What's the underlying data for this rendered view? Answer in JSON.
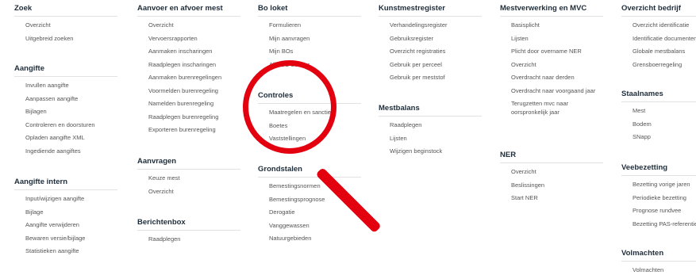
{
  "columns": [
    {
      "sections": [
        {
          "title": "Zoek",
          "items": [
            "Overzicht",
            "Uitgebreid zoeken"
          ]
        },
        {
          "title": "Aangifte",
          "items": [
            "Invullen aangifte",
            "Aanpassen aangifte",
            "Bijlagen",
            "Controleren en doorsturen",
            "Opladen aangifte XML",
            "Ingediende aangiftes"
          ]
        },
        {
          "title": "Aangifte intern",
          "items": [
            "Input/wijzigen aangifte",
            "Bijlage",
            "Aangifte verwijderen",
            "Bewaren versie/bijlage",
            "Statistieken aangifte"
          ]
        }
      ]
    },
    {
      "sections": [
        {
          "title": "Aanvoer en afvoer mest",
          "items": [
            "Overzicht",
            "Vervoersrapporten",
            "Aanmaken inscharingen",
            "Raadplegen inscharingen",
            "Aanmaken burenregelingen",
            "Voormelden burenregeling",
            "Namelden burenregeling",
            "Raadplegen burenregeling",
            "Exporteren burenregeling"
          ]
        },
        {
          "title": "Aanvragen",
          "items": [
            "Keuze mest",
            "Overzicht"
          ]
        },
        {
          "title": "Berichtenbox",
          "items": [
            "Raadplegen"
          ]
        }
      ]
    },
    {
      "sections": [
        {
          "title": "Bo loket",
          "items": [
            "Formulieren",
            "Mijn aanvragen",
            "Mijn BOs",
            "Alle BO-beheer"
          ]
        },
        {
          "title": "Controles",
          "items": [
            "Maatregelen en sancties",
            "Boetes",
            "Vaststellingen"
          ]
        },
        {
          "title": "Grondstalen",
          "items": [
            "Bemestingsnormen",
            "Bemestingsprognose",
            "Derogatie",
            "Vanggewassen",
            "Natuurgebieden"
          ]
        }
      ]
    },
    {
      "sections": [
        {
          "title": "Kunstmestregister",
          "items": [
            "Verhandelingsregister",
            "Gebruiksregister",
            "Overzicht registraties",
            "Gebruik per perceel",
            "Gebruik per meststof"
          ]
        },
        {
          "title": "Mestbalans",
          "items": [
            "Raadplegen",
            "Lijsten",
            "Wijzigen beginstock"
          ]
        }
      ]
    },
    {
      "sections": [
        {
          "title": "Mestverwerking en MVC",
          "items": [
            "Basisplicht",
            "Lijsten",
            "Plicht door overname NER",
            "Overzicht",
            "Overdracht naar derden",
            "Overdracht naar voorgaand jaar",
            "Terugzetten mvc naar oorspronkelijk jaar"
          ]
        },
        {
          "title": "NER",
          "items": [
            "Overzicht",
            "Beslissingen",
            "Start NER"
          ]
        }
      ]
    },
    {
      "sections": [
        {
          "title": "Overzicht bedrijf",
          "items": [
            "Overzicht identificatie",
            "Identificatie documenten",
            "Globale mestbalans",
            "Grensboerregeling"
          ]
        },
        {
          "title": "Staalnames",
          "items": [
            "Mest",
            "Bodem",
            "SNapp"
          ]
        },
        {
          "title": "Veebezetting",
          "items": [
            "Bezetting vorige jaren",
            "Periodieke bezetting",
            "Prognose rundvee",
            "Bezetting PAS-referentie"
          ]
        },
        {
          "title": "Volmachten",
          "items": [
            "Volmachten"
          ]
        }
      ]
    }
  ],
  "highlight": {
    "color": "#e3000f"
  }
}
